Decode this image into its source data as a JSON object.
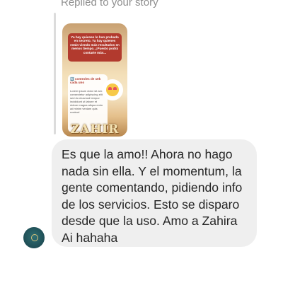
{
  "reply_context": {
    "label": "Replied to your story"
  },
  "story": {
    "banner_text": "Ya hay quienes lo han probado en secreto. Ya hay quienes están viendo más resultados en menos tiempo. ¿Puesto podrá contarte más...",
    "card_title": "🔟 controles de 10k cada uno",
    "card_text": "Lorem ipsum dolor sit amet consectetur adipiscing elit sed do eiusmod tempor incididunt ut labore et dolore magna aliqua enim ad minim veniam quis nostrud",
    "logo_text": "ZAHIR",
    "sticker_icon": "smiling-face-with-hearts-icon"
  },
  "message": {
    "text": "Es que la amo!! Ahora no hago nada sin ella. Y el momentum, la gente comentando, pidiendo info de los servicios. Esto se disparo desde que la uso. Amo a Zahira Ai hahaha"
  },
  "sender": {
    "avatar_icon": "brand-logo-icon"
  }
}
